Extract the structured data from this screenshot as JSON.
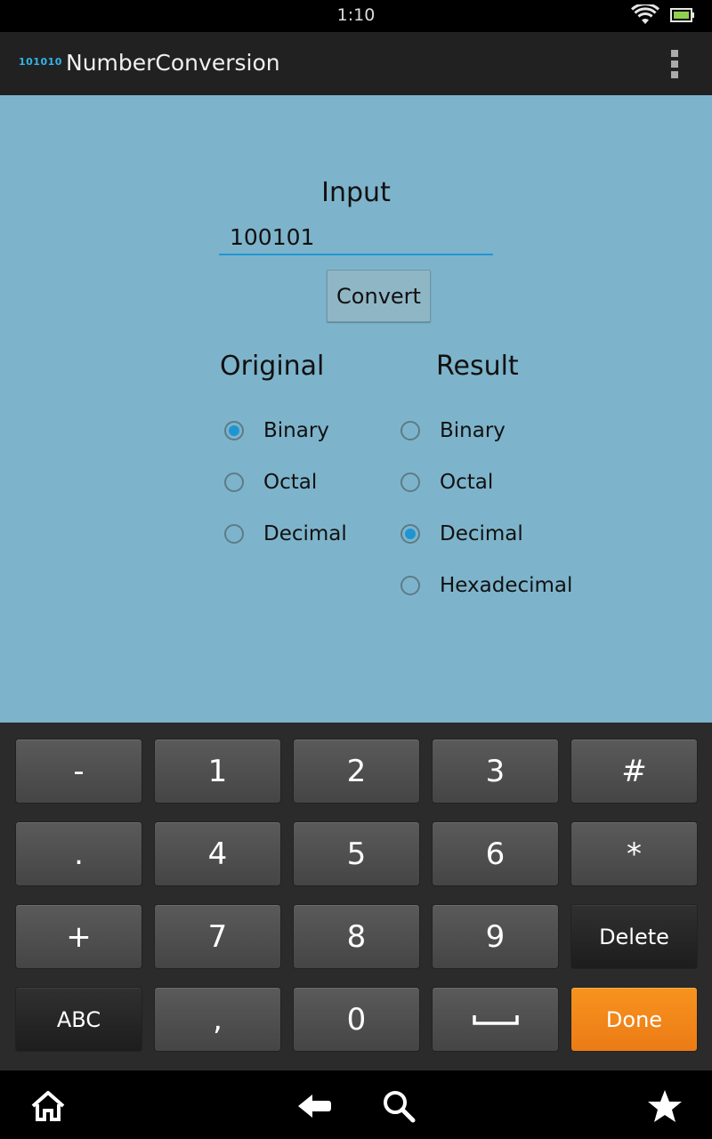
{
  "status_bar": {
    "time": "1:10",
    "icons": [
      "wifi-icon",
      "battery-icon"
    ]
  },
  "app_bar": {
    "logo_text": "101010",
    "title": "NumberConversion",
    "menu_icon": "overflow-menu-icon"
  },
  "form": {
    "input_label": "Input",
    "input_value": "100101",
    "convert_label": "Convert"
  },
  "original": {
    "title": "Original",
    "options": [
      {
        "label": "Binary",
        "checked": true
      },
      {
        "label": "Octal",
        "checked": false
      },
      {
        "label": "Decimal",
        "checked": false
      }
    ]
  },
  "result": {
    "title": "Result",
    "options": [
      {
        "label": "Binary",
        "checked": false
      },
      {
        "label": "Octal",
        "checked": false
      },
      {
        "label": "Decimal",
        "checked": true
      },
      {
        "label": "Hexadecimal",
        "checked": false
      }
    ]
  },
  "keyboard": {
    "rows": [
      [
        "-",
        "1",
        "2",
        "3",
        "#"
      ],
      [
        ".",
        "4",
        "5",
        "6",
        "*"
      ],
      [
        "+",
        "7",
        "8",
        "9",
        "Delete"
      ],
      [
        "ABC",
        ",",
        "0",
        "space-bar-icon",
        "Done"
      ]
    ]
  },
  "nav_bar": {
    "icons": [
      "home-icon",
      "back-icon",
      "search-icon",
      "star-icon"
    ]
  },
  "colors": {
    "accent": "#1e95d0",
    "content_bg": "#7db4cb",
    "done_key": "#f7931e",
    "action_bar": "#212121"
  }
}
